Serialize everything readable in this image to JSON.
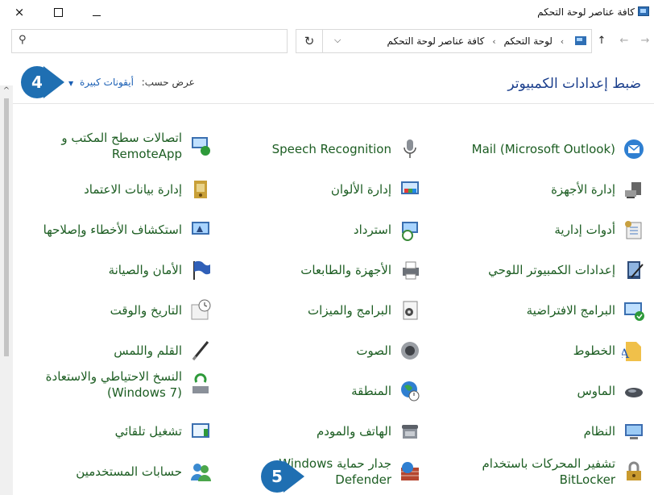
{
  "window": {
    "title": "كافة عناصر لوحة التحكم",
    "close_glyph": "×"
  },
  "address": {
    "crumbs": [
      "لوحة التحكم",
      "كافة عناصر لوحة التحكم"
    ],
    "separator": "›",
    "refresh_glyph": "↻",
    "dropdown_glyph": "⌵",
    "nav": {
      "back": "←",
      "forward": "→",
      "up": "↑"
    },
    "search_glyph": "⚲"
  },
  "header": {
    "title": "ضبط إعدادات الكمبيوتر",
    "view_by_label": "عرض حسب:",
    "view_by_value": "أيقونات كبيرة"
  },
  "scroll_up_glyph": "^",
  "badges": [
    "4",
    "5"
  ],
  "items": {
    "right": [
      {
        "label": "Mail (Microsoft Outlook)",
        "icon": "mail-icon"
      },
      {
        "label": "إدارة الأجهزة",
        "icon": "device-manager-icon"
      },
      {
        "label": "أدوات إدارية",
        "icon": "admin-tools-icon"
      },
      {
        "label": "إعدادات الكمبيوتر اللوحي",
        "icon": "tablet-settings-icon"
      },
      {
        "label": "البرامج الافتراضية",
        "icon": "default-programs-icon"
      },
      {
        "label": "الخطوط",
        "icon": "fonts-icon"
      },
      {
        "label": "الماوس",
        "icon": "mouse-icon"
      },
      {
        "label": "النظام",
        "icon": "system-icon"
      },
      {
        "label": "تشفير المحركات باستخدام BitLocker",
        "icon": "bitlocker-icon"
      }
    ],
    "middle": [
      {
        "label": "Speech Recognition",
        "icon": "microphone-icon"
      },
      {
        "label": "إدارة الألوان",
        "icon": "color-management-icon"
      },
      {
        "label": "استرداد",
        "icon": "recovery-icon"
      },
      {
        "label": "الأجهزة والطابعات",
        "icon": "printer-icon"
      },
      {
        "label": "البرامج والميزات",
        "icon": "programs-icon"
      },
      {
        "label": "الصوت",
        "icon": "speaker-icon"
      },
      {
        "label": "المنطقة",
        "icon": "region-icon"
      },
      {
        "label": "الهاتف والمودم",
        "icon": "phone-icon"
      },
      {
        "label": "جدار حماية Windows Defender",
        "icon": "firewall-icon"
      }
    ],
    "left": [
      {
        "label": "اتصالات سطح المكتب و RemoteApp",
        "icon": "remoteapp-icon"
      },
      {
        "label": "إدارة بيانات الاعتماد",
        "icon": "credential-icon"
      },
      {
        "label": "استكشاف الأخطاء وإصلاحها",
        "icon": "troubleshooting-icon"
      },
      {
        "label": "الأمان والصيانة",
        "icon": "flag-icon"
      },
      {
        "label": "التاريخ والوقت",
        "icon": "clock-icon"
      },
      {
        "label": "القلم واللمس",
        "icon": "pen-icon"
      },
      {
        "label": "النسخ الاحتياطي والاستعادة (Windows 7)",
        "icon": "backup-icon"
      },
      {
        "label": "تشغيل تلقائي",
        "icon": "autoplay-icon"
      },
      {
        "label": "حسابات المستخدمين",
        "icon": "users-icon"
      }
    ]
  }
}
